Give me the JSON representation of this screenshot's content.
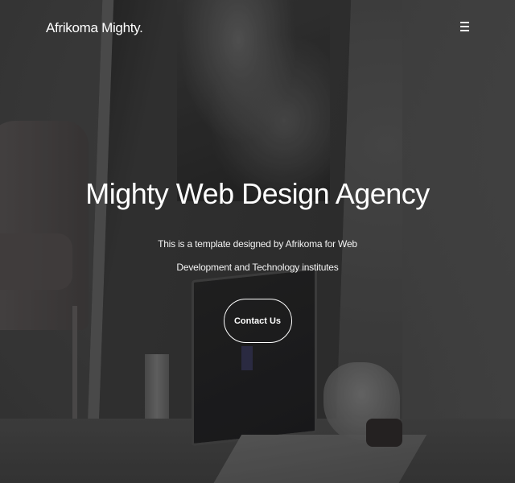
{
  "navbar": {
    "brand": "Afrikoma Mighty.",
    "menu_icon": "hamburger-menu-icon"
  },
  "hero": {
    "title": "Mighty Web Design Agency",
    "subtitle": "This is a template designed by Afrikoma for Web Development and Technology institutes",
    "cta_label": "Contact Us"
  },
  "colors": {
    "text": "#ffffff",
    "overlay": "#141414",
    "button_border": "#ffffff"
  }
}
